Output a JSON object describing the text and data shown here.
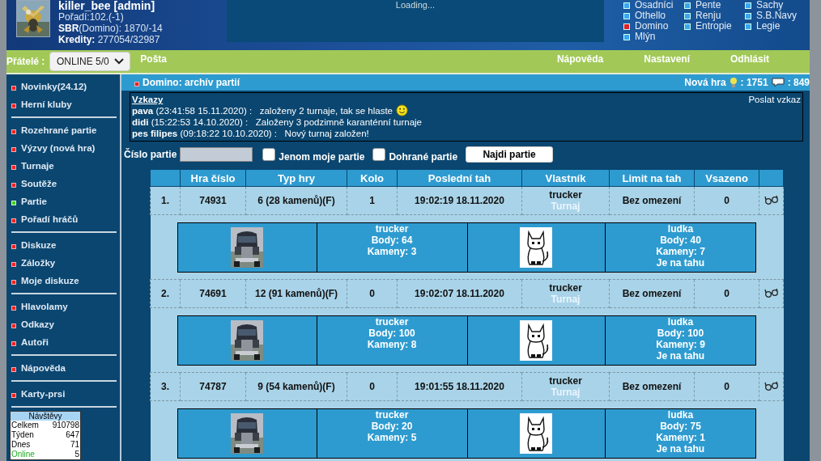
{
  "header": {
    "user": {
      "name": "killer_bee [admin]",
      "lines": [
        "Pořadí:102.(-1)",
        "**SBR**(Domino): 1870/-14",
        "**Kredity:** 277054/32987"
      ]
    },
    "loading": "Loading...",
    "games": [
      {
        "label": "Osadníci",
        "selected": false
      },
      {
        "label": "Pente",
        "selected": false
      },
      {
        "label": "Šachy",
        "selected": false
      },
      {
        "label": "Othello",
        "selected": false
      },
      {
        "label": "Renju",
        "selected": false
      },
      {
        "label": "S.B.Navy",
        "selected": false
      },
      {
        "label": "Domino",
        "selected": true
      },
      {
        "label": "Entropie",
        "selected": false
      },
      {
        "label": "Legie",
        "selected": false
      },
      {
        "label": "Mlýn",
        "selected": false
      }
    ]
  },
  "nav": {
    "friends_label": "Přátelé :",
    "friends_select": "ONLINE 5/0",
    "links_left": [
      "Pošta"
    ],
    "links_right": [
      "Nápověda",
      "Nastavení",
      "Odhlásit"
    ]
  },
  "sidebar": {
    "groups": [
      [
        {
          "label": "Novinky(24.12)",
          "selected": false
        },
        {
          "label": "Herní kluby",
          "selected": false
        }
      ],
      [
        {
          "label": "Rozehrané partie",
          "selected": false
        },
        {
          "label": "Výzvy (nová hra)",
          "selected": false
        },
        {
          "label": "Turnaje",
          "selected": false
        },
        {
          "label": "Soutěže",
          "selected": false
        },
        {
          "label": "Partie",
          "selected": true
        },
        {
          "label": "Pořadí hráčů",
          "selected": false
        }
      ],
      [
        {
          "label": "Diskuze",
          "selected": false
        },
        {
          "label": "Záložky",
          "selected": false
        },
        {
          "label": "Moje diskuze",
          "selected": false
        }
      ],
      [
        {
          "label": "Hlavolamy",
          "selected": false
        },
        {
          "label": "Odkazy",
          "selected": false
        },
        {
          "label": "Autoři",
          "selected": false
        }
      ],
      [
        {
          "label": "Nápověda",
          "selected": false
        }
      ],
      [
        {
          "label": "Karty-prsi",
          "selected": false
        }
      ]
    ],
    "visits": {
      "title": "Návštěvy",
      "rows": [
        {
          "label": "Celkem",
          "value": "910798",
          "kind": "normal"
        },
        {
          "label": "Týden",
          "value": "647",
          "kind": "normal"
        },
        {
          "label": "Dnes",
          "value": "71",
          "kind": "normal"
        },
        {
          "label": "Online",
          "value": "5",
          "kind": "online"
        }
      ]
    }
  },
  "main": {
    "title": "Domino: archív partií",
    "new_game_label": "Nová hra",
    "new_games": ": 1751",
    "messages_count": ": 849",
    "messages": {
      "title": "Vzkazy",
      "send": "Poslat vzkaz",
      "items": [
        {
          "author": "pava",
          "time": "(23:41:58  15.11.2020) :",
          "text": "založeny 2 turnaje, tak se hlaste",
          "smiley": true
        },
        {
          "author": "didi",
          "time": "(15:22:53  14.10.2020) :",
          "text": "Založeny 3 podzimně karanténní turnaje"
        },
        {
          "author": "pes filipes",
          "time": "(09:18:22  10.10.2020) :",
          "text": "Nový turnaj založen!"
        }
      ]
    },
    "filter": {
      "number_label": "Číslo partie",
      "only_mine": {
        "label": "Jenom moje partie",
        "checked": false
      },
      "finished": {
        "label": "Dohrané partie",
        "checked": false
      },
      "search_button": "Najdi partie"
    },
    "table": {
      "columns": [
        "Hra číslo",
        "Typ hry",
        "Kolo",
        "Poslední tah",
        "Vlastník",
        "Limit na tah",
        "Vsazeno"
      ],
      "rows": [
        {
          "index": "1.",
          "number": "74931",
          "type": "6 (28 kamenů)(F)",
          "round": "1",
          "last_move": "19:02:19  18.11.2020",
          "owner": "trucker",
          "tournament": "Turnaj",
          "limit": "Bez omezení",
          "stake": "0",
          "players": [
            {
              "name": "trucker",
              "points": "Body: 64",
              "stones": "Kameny: 3"
            },
            {
              "name": "ludka",
              "points": "Body: 40",
              "stones": "Kameny: 7",
              "turn_note": "Je na tahu"
            }
          ]
        },
        {
          "index": "2.",
          "number": "74691",
          "type": "12 (91 kamenů)(F)",
          "round": "0",
          "last_move": "19:02:07  18.11.2020",
          "owner": "trucker",
          "tournament": "Turnaj",
          "limit": "Bez omezení",
          "stake": "0",
          "players": [
            {
              "name": "trucker",
              "points": "Body: 100",
              "stones": "Kameny: 8"
            },
            {
              "name": "ludka",
              "points": "Body: 100",
              "stones": "Kameny: 9",
              "turn_note": "Je na tahu"
            }
          ]
        },
        {
          "index": "3.",
          "number": "74787",
          "type": "9 (54 kamenů)(F)",
          "round": "0",
          "last_move": "19:01:55  18.11.2020",
          "owner": "trucker",
          "tournament": "Turnaj",
          "limit": "Bez omezení",
          "stake": "0",
          "players": [
            {
              "name": "trucker",
              "points": "Body: 20",
              "stones": "Kameny: 5"
            },
            {
              "name": "ludka",
              "points": "Body: 75",
              "stones": "Kameny: 1",
              "turn_note": "Je na tahu"
            }
          ]
        }
      ]
    }
  }
}
